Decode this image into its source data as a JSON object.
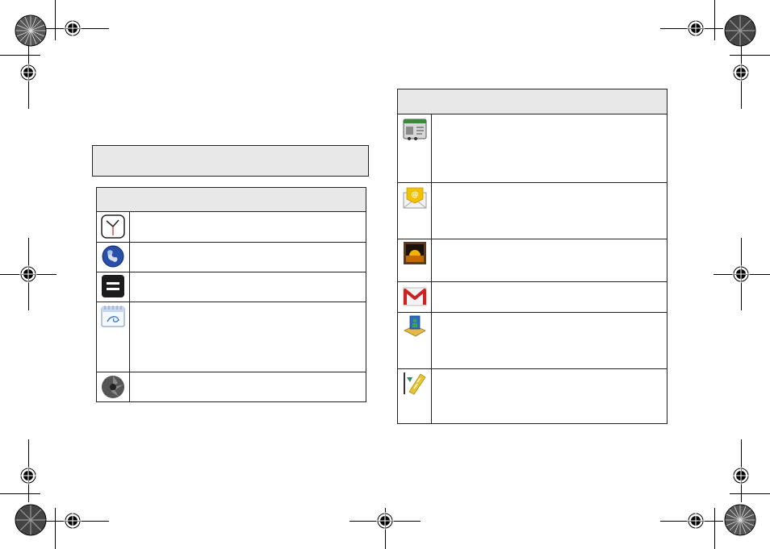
{
  "page": {
    "note_box_text": "",
    "left_table": {
      "header": "",
      "rows": [
        {
          "icon": "clock-icon",
          "text": ""
        },
        {
          "icon": "globe-icon",
          "text": ""
        },
        {
          "icon": "menu-bars-icon",
          "text": ""
        },
        {
          "icon": "calendar-icon",
          "text": ""
        },
        {
          "icon": "camera-aperture-icon",
          "text": ""
        }
      ]
    },
    "right_table": {
      "header": "",
      "rows": [
        {
          "icon": "car-home-icon",
          "text": ""
        },
        {
          "icon": "email-icon",
          "text": ""
        },
        {
          "icon": "gallery-icon",
          "text": ""
        },
        {
          "icon": "gmail-icon",
          "text": ""
        },
        {
          "icon": "latitude-map-icon",
          "text": ""
        },
        {
          "icon": "navigation-icon",
          "text": ""
        }
      ]
    }
  },
  "colors": {
    "header_gray": "#e8e8e8",
    "border": "#222222",
    "gmail_red": "#cc2222",
    "email_yellow": "#f2c200"
  }
}
